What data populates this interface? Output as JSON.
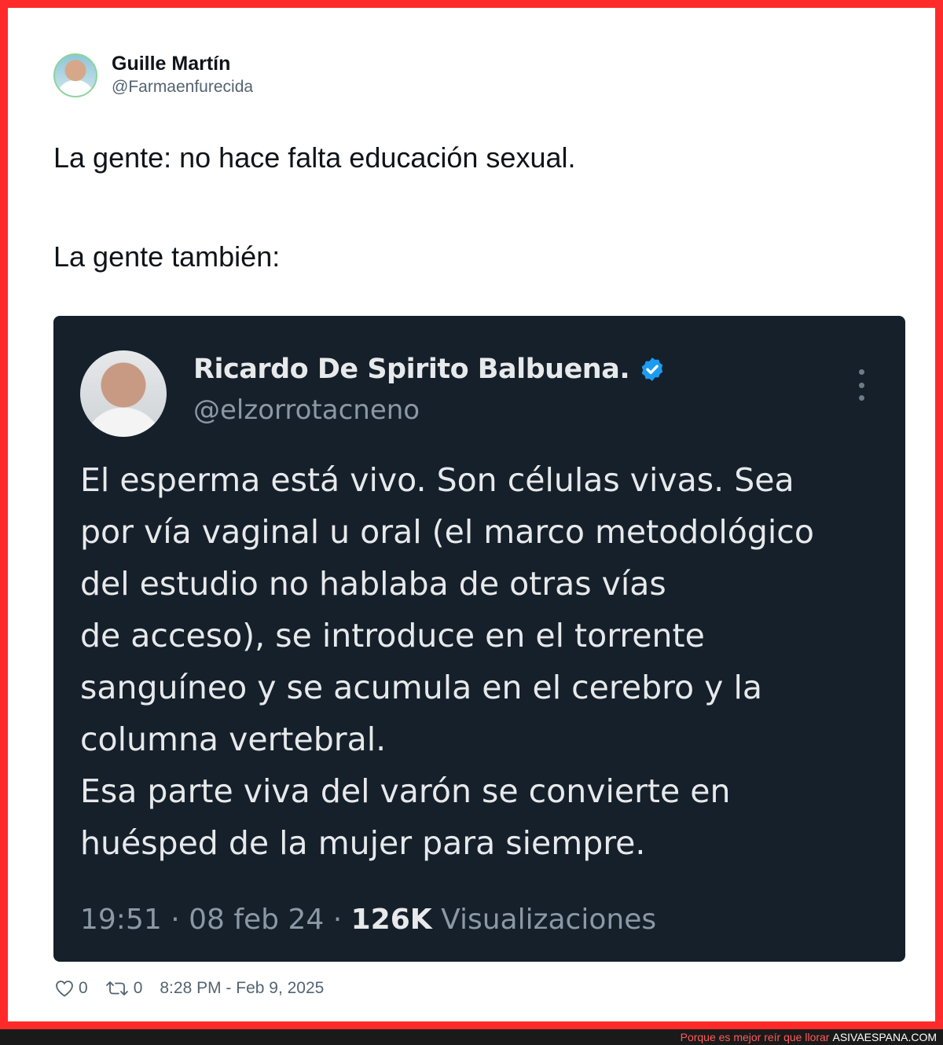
{
  "author": {
    "display_name": "Guille Martín",
    "handle": "@Farmaenfurecida"
  },
  "tweet": {
    "line1": "La gente: no hace falta educación sexual.",
    "line2": "La gente también:"
  },
  "quoted": {
    "display_name": "Ricardo De Spirito Balbuena.",
    "handle": "@elzorrotacneno",
    "verified_color": "#1d9bf0",
    "body_lines": [
      "El esperma está vivo. Son células vivas. Sea",
      "por vía vaginal u oral (el marco metodológico",
      "del estudio no hablaba de otras vías",
      "de acceso), se introduce en el torrente",
      "sanguíneo y se acumula en el cerebro y la",
      "columna vertebral.",
      "Esa parte viva del varón se convierte en",
      "huésped de la mujer para siempre."
    ],
    "time": "19:51",
    "date": "08 feb 24",
    "views_count": "126K",
    "views_label": "Visualizaciones"
  },
  "actions": {
    "likes": "0",
    "retweets": "0",
    "timestamp": "8:28 PM - Feb 9, 2025"
  },
  "footer": {
    "tagline": "Porque es mejor reír que llorar",
    "site": "ASIVAESPANA.COM"
  },
  "colors": {
    "frame": "#ff2b2b",
    "embed_bg": "#15202b",
    "footer_bg": "#1a1a1a"
  }
}
